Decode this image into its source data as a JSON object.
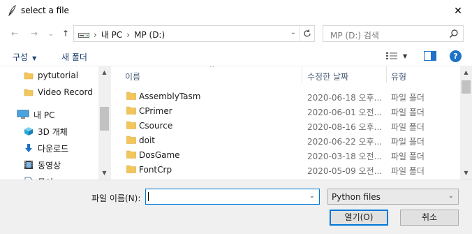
{
  "window": {
    "title": "select a file",
    "close_glyph": "✕"
  },
  "nav": {
    "back_glyph": "←",
    "forward_glyph": "→",
    "recent_glyph": "⌄",
    "up_glyph": "↑"
  },
  "address": {
    "crumbs": [
      "내 PC",
      "MP (D:)"
    ],
    "separator": "›",
    "icon": "drive-icon"
  },
  "search": {
    "placeholder": "MP (D:) 검색"
  },
  "toolbar": {
    "organize_label": "구성",
    "new_folder_label": "새 폴더",
    "help_label": "?"
  },
  "sidebar": {
    "items": [
      {
        "label": "pytutorial",
        "icon": "folder-icon"
      },
      {
        "label": "Video Record",
        "icon": "folder-icon"
      },
      {
        "label": "내 PC",
        "icon": "pc-icon"
      },
      {
        "label": "3D 개체",
        "icon": "cube-icon"
      },
      {
        "label": "다운로드",
        "icon": "download-icon"
      },
      {
        "label": "동영상",
        "icon": "film-icon"
      },
      {
        "label": "문서",
        "icon": "document-icon"
      }
    ]
  },
  "filelist": {
    "columns": [
      "이름",
      "수정한 날짜",
      "유형"
    ],
    "rows": [
      {
        "name": "AssemblyTasm",
        "date": "2020-06-18 오후...",
        "type": "파일 폴더"
      },
      {
        "name": "CPrimer",
        "date": "2020-06-01 오전...",
        "type": "파일 폴더"
      },
      {
        "name": "Csource",
        "date": "2020-08-16 오후...",
        "type": "파일 폴더"
      },
      {
        "name": "doit",
        "date": "2020-06-22 오후...",
        "type": "파일 폴더"
      },
      {
        "name": "DosGame",
        "date": "2020-03-18 오전...",
        "type": "파일 폴더"
      },
      {
        "name": "FontCrp",
        "date": "2020-05-09 오전...",
        "type": "파일 폴더"
      }
    ]
  },
  "footer": {
    "filename_label": "파일 이름(N):",
    "filename_value": "",
    "filter_value": "Python files",
    "open_label": "열기(O)",
    "cancel_label": "취소"
  },
  "colors": {
    "accent": "#0078d7",
    "folder": "#f3c65b",
    "link": "#1a3e6e"
  }
}
